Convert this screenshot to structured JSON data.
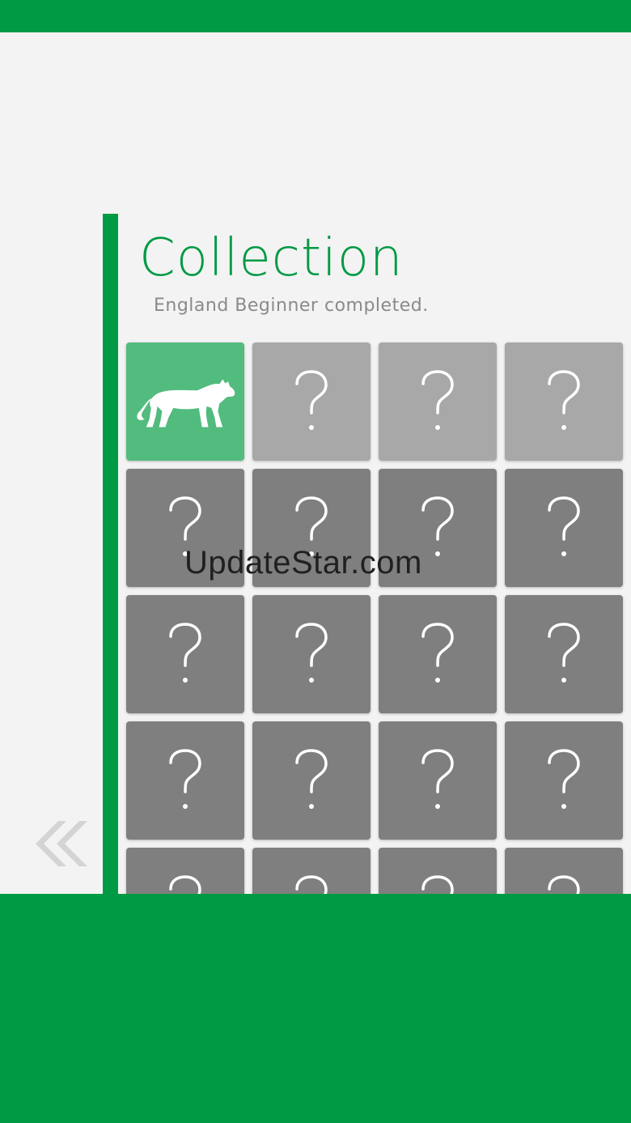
{
  "header": {
    "title": "Collection",
    "subtitle": "England Beginner completed."
  },
  "colors": {
    "brand": "#009a44",
    "unlocked_card": "#52bb7e",
    "available_card": "#a8a8a8",
    "locked_card": "#7f7f7f"
  },
  "collection": {
    "items": [
      {
        "state": "unlocked",
        "icon": "tiger-icon"
      },
      {
        "state": "available",
        "icon": "question-mark-icon"
      },
      {
        "state": "available",
        "icon": "question-mark-icon"
      },
      {
        "state": "available",
        "icon": "question-mark-icon"
      },
      {
        "state": "locked",
        "icon": "question-mark-icon"
      },
      {
        "state": "locked",
        "icon": "question-mark-icon"
      },
      {
        "state": "locked",
        "icon": "question-mark-icon"
      },
      {
        "state": "locked",
        "icon": "question-mark-icon"
      },
      {
        "state": "locked",
        "icon": "question-mark-icon"
      },
      {
        "state": "locked",
        "icon": "question-mark-icon"
      },
      {
        "state": "locked",
        "icon": "question-mark-icon"
      },
      {
        "state": "locked",
        "icon": "question-mark-icon"
      },
      {
        "state": "locked",
        "icon": "question-mark-icon"
      },
      {
        "state": "locked",
        "icon": "question-mark-icon"
      },
      {
        "state": "locked",
        "icon": "question-mark-icon"
      },
      {
        "state": "locked",
        "icon": "question-mark-icon"
      },
      {
        "state": "locked",
        "icon": "question-mark-icon"
      },
      {
        "state": "locked",
        "icon": "question-mark-icon"
      },
      {
        "state": "locked",
        "icon": "question-mark-icon"
      },
      {
        "state": "locked",
        "icon": "question-mark-icon"
      }
    ]
  },
  "navigation": {
    "back_icon": "double-chevron-left-icon"
  },
  "watermark": {
    "text": "UpdateStar.com"
  }
}
